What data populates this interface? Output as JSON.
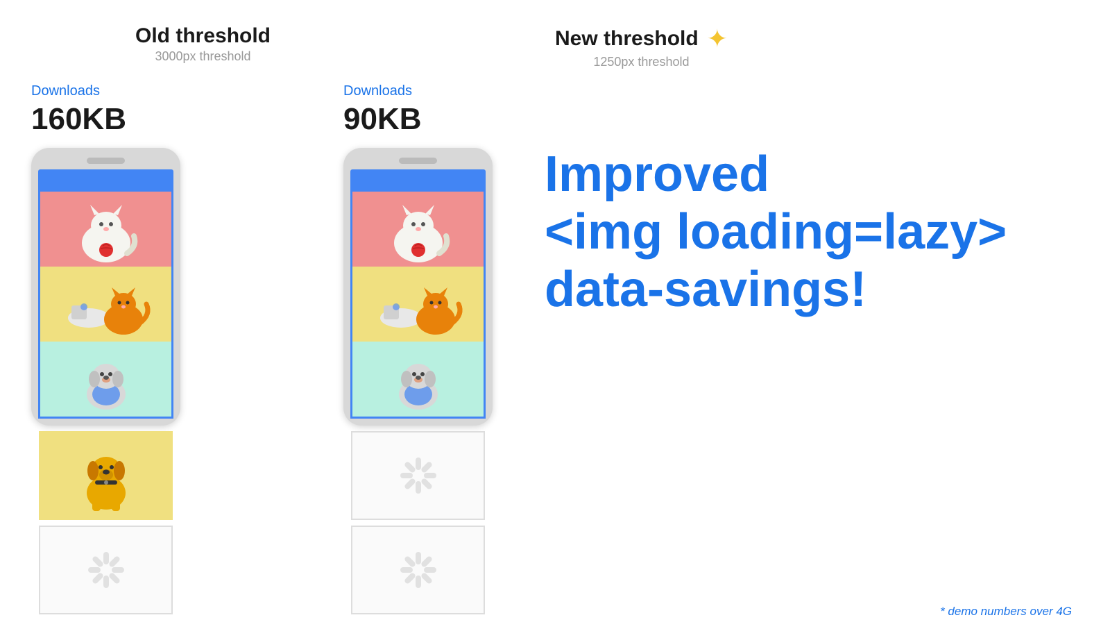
{
  "old_threshold": {
    "title": "Old threshold",
    "subtitle": "3000px threshold",
    "downloads_label": "Downloads",
    "downloads_size": "160KB"
  },
  "new_threshold": {
    "title": "New threshold",
    "subtitle": "1250px threshold",
    "downloads_label": "Downloads",
    "downloads_size": "90KB"
  },
  "right_section": {
    "line1": "Improved",
    "line2": "<img loading=lazy>",
    "line3": "data-savings!"
  },
  "demo_note": "* demo numbers over 4G",
  "sparkle": "✦"
}
